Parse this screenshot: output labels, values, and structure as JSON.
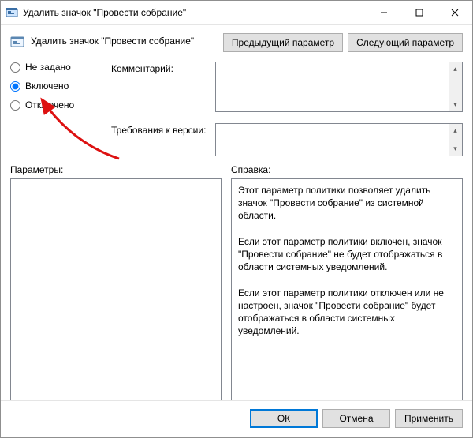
{
  "window": {
    "title": "Удалить значок \"Провести собрание\""
  },
  "header": {
    "title": "Удалить значок \"Провести собрание\"",
    "prev_button": "Предыдущий параметр",
    "next_button": "Следующий параметр"
  },
  "state": {
    "not_configured_label": "Не задано",
    "enabled_label": "Включено",
    "disabled_label": "Отключено",
    "selected": "enabled"
  },
  "fields": {
    "comment_label": "Комментарий:",
    "comment_value": "",
    "version_label": "Требования к версии:",
    "version_value": ""
  },
  "lower": {
    "params_label": "Параметры:",
    "help_label": "Справка:",
    "help_text": "Этот параметр политики позволяет удалить значок \"Провести собрание\" из системной области.\n\nЕсли этот параметр политики включен, значок \"Провести собрание\" не будет отображаться в области системных уведомлений.\n\nЕсли этот параметр политики отключен или не настроен, значок \"Провести собрание\" будет отображаться в области системных уведомлений."
  },
  "footer": {
    "ok": "ОК",
    "cancel": "Отмена",
    "apply": "Применить"
  }
}
